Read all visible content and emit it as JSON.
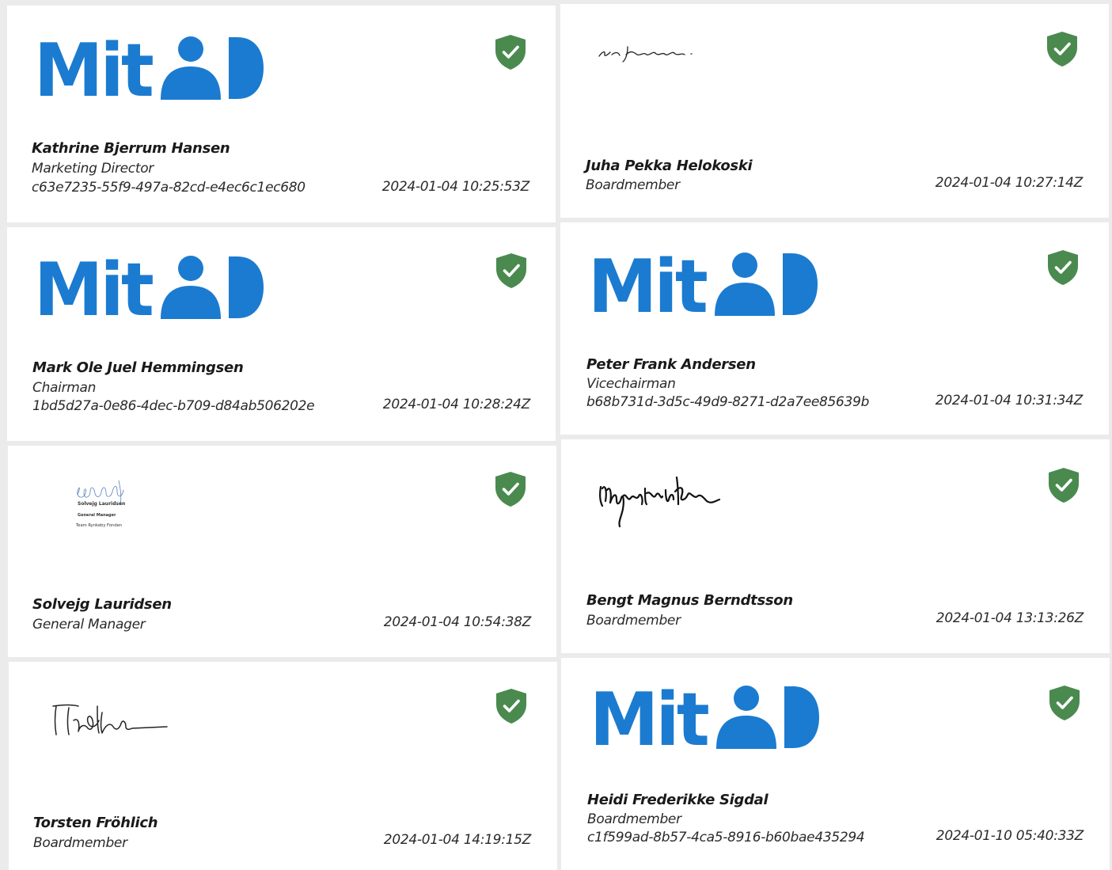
{
  "logo": {
    "text": "Mit",
    "color": "#1b7bd0"
  },
  "badge": {
    "color": "#4a8a4f",
    "icon": "verified-shield-icon"
  },
  "signatures": [
    {
      "name": "Kathrine Bjerrum Hansen",
      "role": "Marketing Director",
      "uuid": "c63e7235-55f9-497a-82cd-e4ec6c1ec680",
      "timestamp": "2024-01-04 10:25:53Z",
      "mark": "mitid-logo"
    },
    {
      "name": "Juha Pekka Helokoski",
      "role": "Boardmember",
      "timestamp": "2024-01-04 10:27:14Z",
      "mark": "handwritten-signature"
    },
    {
      "name": "Mark Ole Juel Hemmingsen",
      "role": "Chairman",
      "uuid": "1bd5d27a-0e86-4dec-b709-d84ab506202e",
      "timestamp": "2024-01-04 10:28:24Z",
      "mark": "mitid-logo"
    },
    {
      "name": "Peter Frank Andersen",
      "role": "Vicechairman",
      "uuid": "b68b731d-3d5c-49d9-8271-d2a7ee85639b",
      "timestamp": "2024-01-04 10:31:34Z",
      "mark": "mitid-logo"
    },
    {
      "name": "Solvejg Lauridsen",
      "role": "General Manager",
      "timestamp": "2024-01-04 10:54:38Z",
      "mark": "handwritten-signature",
      "signature_caption": [
        "Solvejg Lauridsen",
        "General Manager",
        "Team Rynkeby Fonden"
      ]
    },
    {
      "name": "Bengt Magnus Berndtsson",
      "role": "Boardmember",
      "timestamp": "2024-01-04 13:13:26Z",
      "mark": "handwritten-signature"
    },
    {
      "name": "Torsten Fröhlich",
      "role": "Boardmember",
      "timestamp": "2024-01-04 14:19:15Z",
      "mark": "handwritten-signature"
    },
    {
      "name": "Heidi Frederikke Sigdal",
      "role": "Boardmember",
      "uuid": "c1f599ad-8b57-4ca5-8916-b60bae435294",
      "timestamp": "2024-01-10 05:40:33Z",
      "mark": "mitid-logo"
    }
  ]
}
